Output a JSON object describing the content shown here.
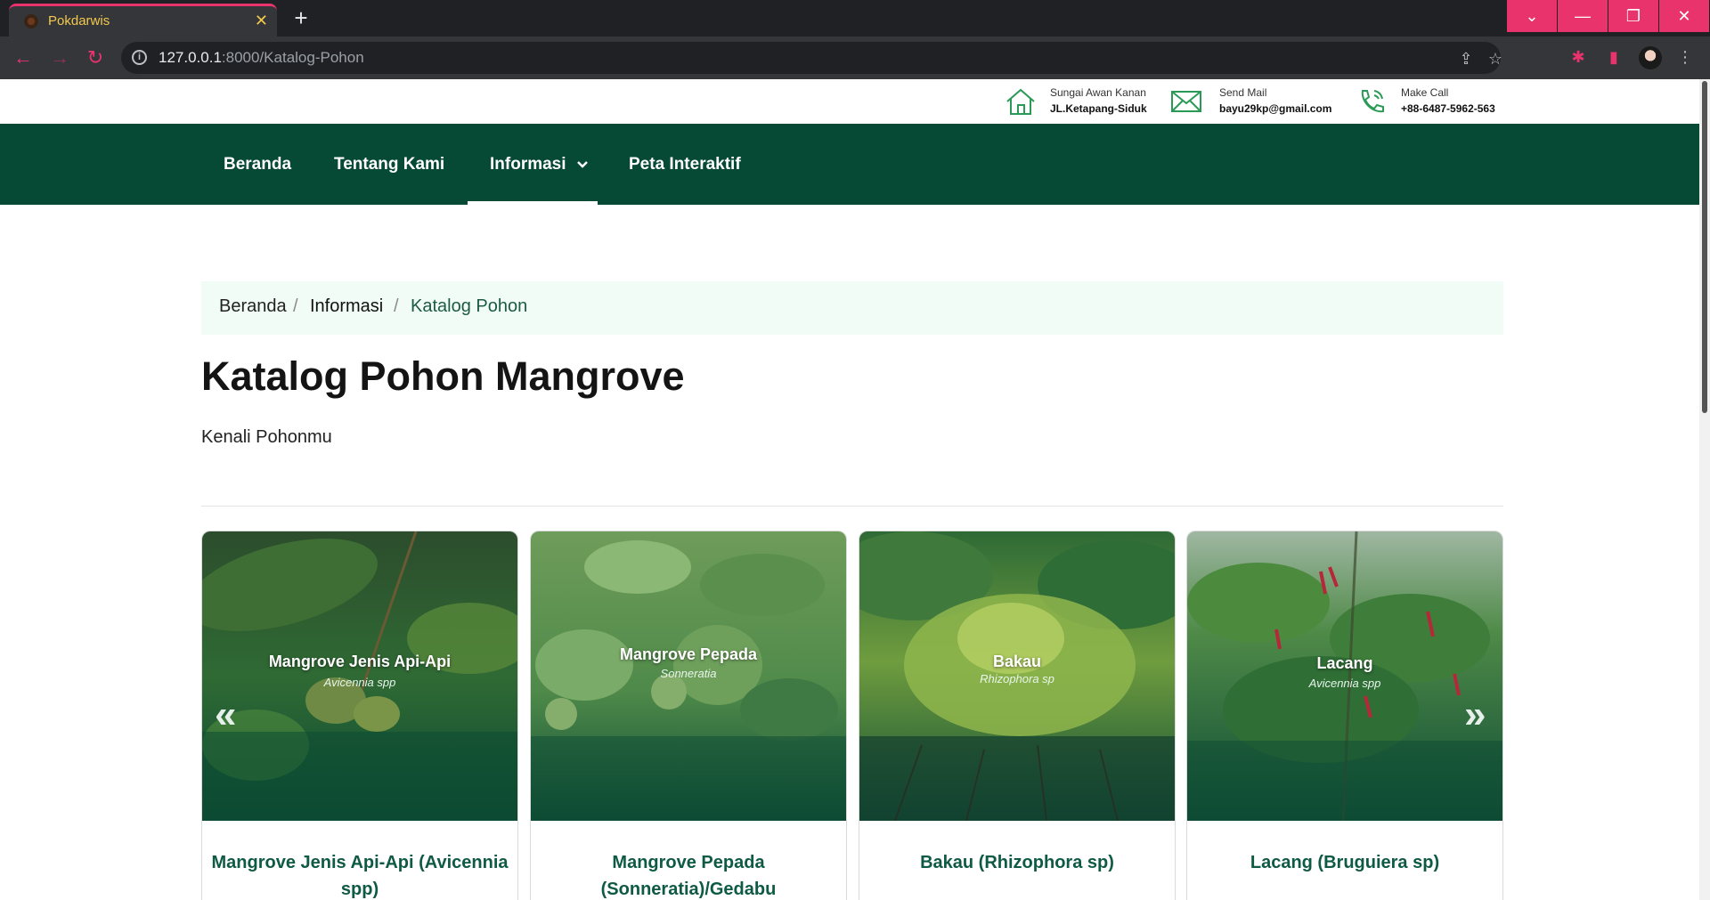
{
  "browser": {
    "tab_title": "Pokdarwis",
    "tab_close": "✕",
    "new_tab": "+",
    "url_host": "127.0.0.1",
    "url_path": ":8000/Katalog-Pohon",
    "window_controls": [
      "⌄",
      "—",
      "❐",
      "✕"
    ],
    "accent_color": "#e8336d"
  },
  "contact": {
    "address": {
      "line1": "Sungai Awan Kanan",
      "line2": "JL.Ketapang-Siduk",
      "icon": "home-icon"
    },
    "mail": {
      "line1": "Send Mail",
      "line2": "bayu29kp@gmail.com",
      "icon": "mail-icon"
    },
    "call": {
      "line1": "Make Call",
      "line2": "+88-6487-5962-563",
      "icon": "phone-icon"
    }
  },
  "nav": {
    "items": [
      {
        "label": "Beranda"
      },
      {
        "label": "Tentang Kami"
      },
      {
        "label": "Informasi",
        "active": true,
        "dropdown": true
      },
      {
        "label": "Peta Interaktif"
      }
    ],
    "background": "#064a35"
  },
  "breadcrumb": {
    "items": [
      "Beranda",
      "Informasi",
      "Katalog Pohon"
    ],
    "separator": "/"
  },
  "page": {
    "title": "Katalog Pohon Mangrove",
    "subtitle": "Kenali Pohonmu"
  },
  "carousel": {
    "prev": "«",
    "next": "»",
    "cards": [
      {
        "overlay_title": "Mangrove Jenis Api-Api",
        "overlay_sub": "Avicennia spp",
        "caption": "Mangrove Jenis Api-Api (Avicennia spp)"
      },
      {
        "overlay_title": "Mangrove Pepada",
        "overlay_sub": "Sonneratia",
        "caption": "Mangrove Pepada (Sonneratia)/Gedabu"
      },
      {
        "overlay_title": "Bakau",
        "overlay_sub": "Rhizophora sp",
        "caption": "Bakau (Rhizophora sp)"
      },
      {
        "overlay_title": "Lacang",
        "overlay_sub": "Avicennia spp",
        "caption": "Lacang (Bruguiera sp)"
      }
    ]
  }
}
